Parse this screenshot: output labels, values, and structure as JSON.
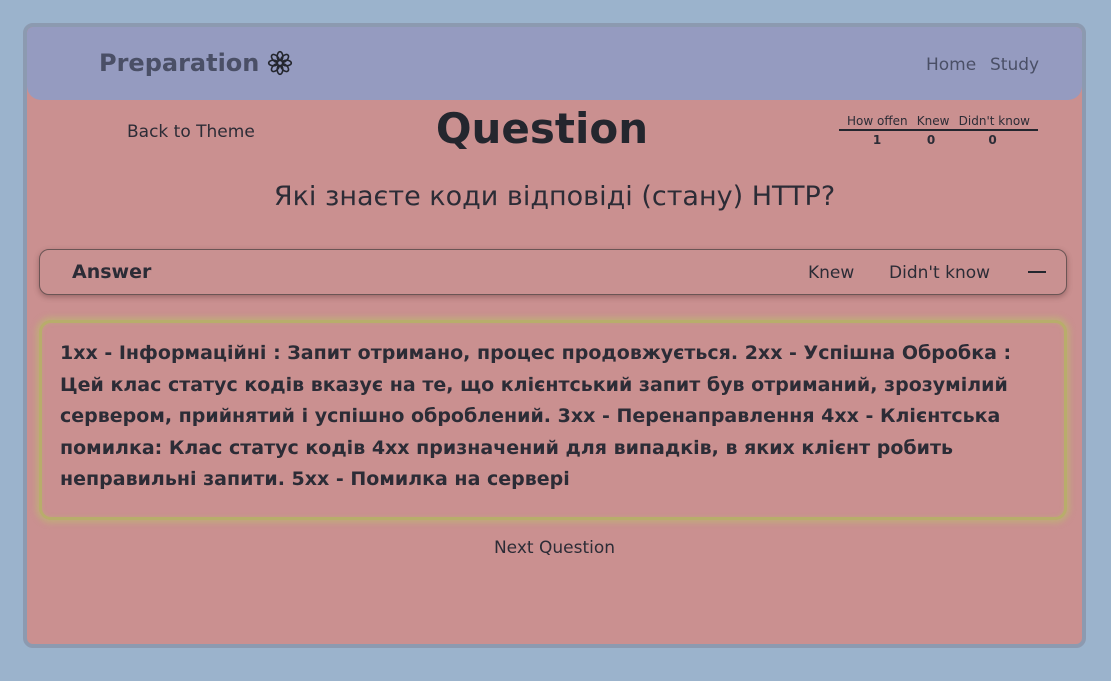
{
  "navbar": {
    "brand": "Preparation",
    "brand_icon": "flower-icon",
    "links": [
      "Home",
      "Study"
    ]
  },
  "header": {
    "back_link": "Back to Theme",
    "title": "Question"
  },
  "stats": {
    "headers": [
      "How offen",
      "Knew",
      "Didn't know"
    ],
    "values": [
      "1",
      "0",
      "0"
    ]
  },
  "question": {
    "text": "Які знаєте коди відповіді (стану) HTTP?"
  },
  "answer_bar": {
    "label": "Answer",
    "knew": "Knew",
    "didnt_know": "Didn't know",
    "collapse_icon": "minus-icon"
  },
  "answer": {
    "text": "1xx - Інформаційні : Запит отримано, процес продовжується. 2xx - Успішна Обробка : Цей клас статус кодів вказує на те, що клієнтський запит був отриманий, зрозумілий сервером, прийнятий і успішно оброблений. 3xx - Перенаправлення 4xx - Клієнтська помилка: Клас статус кодів 4xx призначений для випадків, в яких клієнт робить неправильні запити. 5xx - Помилка на сервері"
  },
  "footer": {
    "next": "Next Question"
  },
  "colors": {
    "background": "#9bb3cc",
    "panel": "#ca9090",
    "navbar": "#959bc0",
    "answer_border": "#b8ad6b"
  }
}
